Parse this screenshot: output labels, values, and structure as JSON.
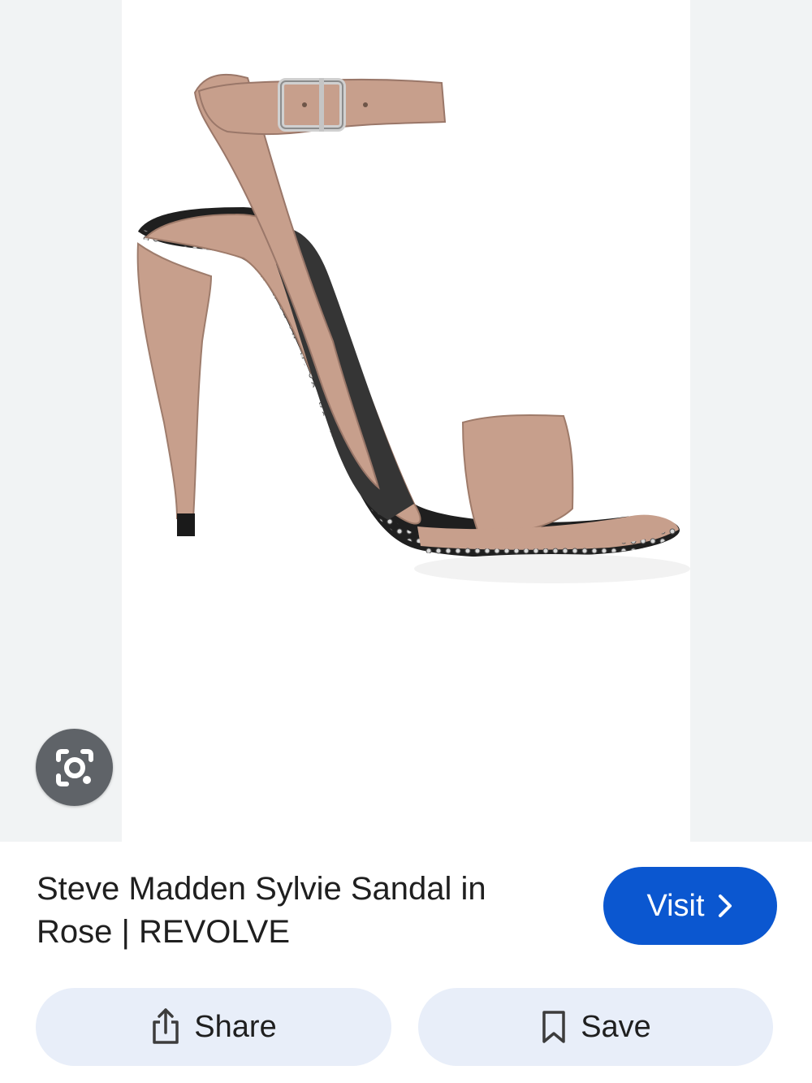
{
  "result": {
    "title": "Steve Madden Sylvie Sandal in Rose | REVOLVE",
    "image_subject": "sandal"
  },
  "actions": {
    "visit_label": "Visit",
    "share_label": "Share",
    "save_label": "Save"
  },
  "icons": {
    "lens": "google-lens-icon",
    "visit": "chevron-right-icon",
    "share": "share-icon",
    "save": "bookmark-icon"
  },
  "colors": {
    "accent": "#0b57d0",
    "action_background": "#e8eef9",
    "lens_background": "#5f6368",
    "sandal": "#c79f8c"
  }
}
